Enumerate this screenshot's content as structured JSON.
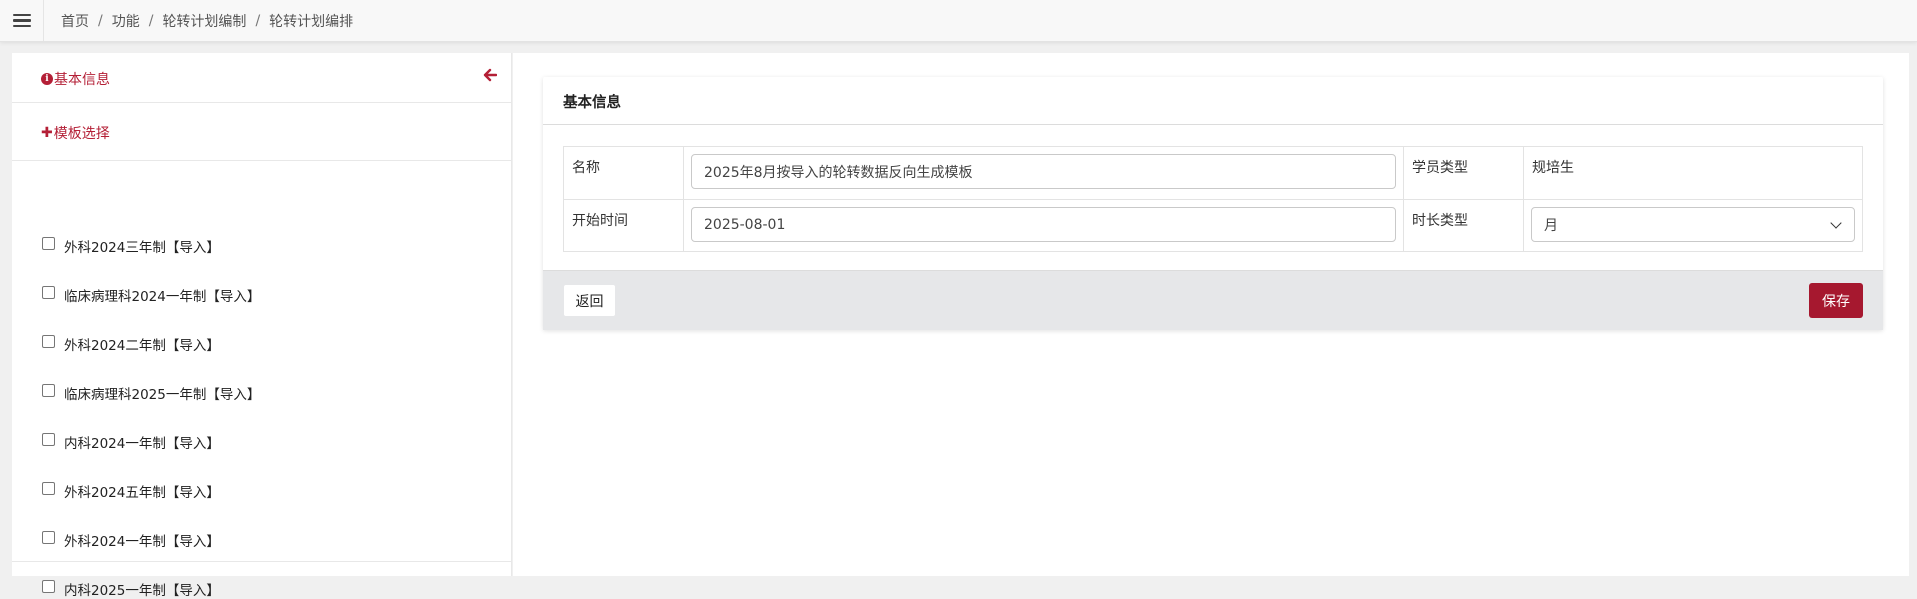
{
  "breadcrumb": {
    "items": [
      "首页",
      "功能",
      "轮转计划编制",
      "轮转计划编排"
    ],
    "separator": "/"
  },
  "sidebar": {
    "basic_info_label": "基本信息",
    "template_select_label": "模板选择",
    "templates": [
      {
        "label": "外科2024三年制【导入】",
        "checked": false
      },
      {
        "label": "临床病理科2024一年制【导入】",
        "checked": false
      },
      {
        "label": "外科2024二年制【导入】",
        "checked": false
      },
      {
        "label": "临床病理科2025一年制【导入】",
        "checked": false
      },
      {
        "label": "内科2024一年制【导入】",
        "checked": false
      },
      {
        "label": "外科2024五年制【导入】",
        "checked": false
      },
      {
        "label": "外科2024一年制【导入】",
        "checked": false
      },
      {
        "label": "内科2025一年制【导入】",
        "checked": false
      }
    ]
  },
  "main": {
    "card_title": "基本信息",
    "form": {
      "name_label": "名称",
      "name_value": "2025年8月按导入的轮转数据反向生成模板",
      "student_type_label": "学员类型",
      "student_type_value": "规培生",
      "start_time_label": "开始时间",
      "start_time_value": "2025-08-01",
      "duration_type_label": "时长类型",
      "duration_type_value": "月"
    },
    "back_label": "返回",
    "save_label": "保存"
  },
  "colors": {
    "accent": "#b41f36",
    "save_button": "#a6182f",
    "footer_bg": "#e6e7e9"
  },
  "icons": {
    "menu": "hamburger-icon",
    "info": "info-circle-icon",
    "collapse": "arrow-left-icon",
    "plus": "plus-icon",
    "select": "chevron-down-icon"
  }
}
